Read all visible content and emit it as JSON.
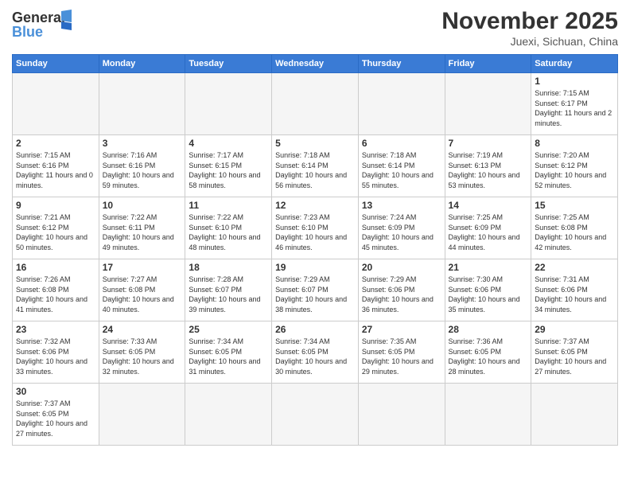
{
  "header": {
    "logo_general": "General",
    "logo_blue": "Blue",
    "month_year": "November 2025",
    "location": "Juexi, Sichuan, China"
  },
  "weekdays": [
    "Sunday",
    "Monday",
    "Tuesday",
    "Wednesday",
    "Thursday",
    "Friday",
    "Saturday"
  ],
  "weeks": [
    [
      {
        "day": "",
        "info": ""
      },
      {
        "day": "",
        "info": ""
      },
      {
        "day": "",
        "info": ""
      },
      {
        "day": "",
        "info": ""
      },
      {
        "day": "",
        "info": ""
      },
      {
        "day": "",
        "info": ""
      },
      {
        "day": "1",
        "info": "Sunrise: 7:15 AM\nSunset: 6:17 PM\nDaylight: 11 hours and 2 minutes."
      }
    ],
    [
      {
        "day": "2",
        "info": "Sunrise: 7:15 AM\nSunset: 6:16 PM\nDaylight: 11 hours and 0 minutes."
      },
      {
        "day": "3",
        "info": "Sunrise: 7:16 AM\nSunset: 6:16 PM\nDaylight: 10 hours and 59 minutes."
      },
      {
        "day": "4",
        "info": "Sunrise: 7:17 AM\nSunset: 6:15 PM\nDaylight: 10 hours and 58 minutes."
      },
      {
        "day": "5",
        "info": "Sunrise: 7:18 AM\nSunset: 6:14 PM\nDaylight: 10 hours and 56 minutes."
      },
      {
        "day": "6",
        "info": "Sunrise: 7:18 AM\nSunset: 6:14 PM\nDaylight: 10 hours and 55 minutes."
      },
      {
        "day": "7",
        "info": "Sunrise: 7:19 AM\nSunset: 6:13 PM\nDaylight: 10 hours and 53 minutes."
      },
      {
        "day": "8",
        "info": "Sunrise: 7:20 AM\nSunset: 6:12 PM\nDaylight: 10 hours and 52 minutes."
      }
    ],
    [
      {
        "day": "9",
        "info": "Sunrise: 7:21 AM\nSunset: 6:12 PM\nDaylight: 10 hours and 50 minutes."
      },
      {
        "day": "10",
        "info": "Sunrise: 7:22 AM\nSunset: 6:11 PM\nDaylight: 10 hours and 49 minutes."
      },
      {
        "day": "11",
        "info": "Sunrise: 7:22 AM\nSunset: 6:10 PM\nDaylight: 10 hours and 48 minutes."
      },
      {
        "day": "12",
        "info": "Sunrise: 7:23 AM\nSunset: 6:10 PM\nDaylight: 10 hours and 46 minutes."
      },
      {
        "day": "13",
        "info": "Sunrise: 7:24 AM\nSunset: 6:09 PM\nDaylight: 10 hours and 45 minutes."
      },
      {
        "day": "14",
        "info": "Sunrise: 7:25 AM\nSunset: 6:09 PM\nDaylight: 10 hours and 44 minutes."
      },
      {
        "day": "15",
        "info": "Sunrise: 7:25 AM\nSunset: 6:08 PM\nDaylight: 10 hours and 42 minutes."
      }
    ],
    [
      {
        "day": "16",
        "info": "Sunrise: 7:26 AM\nSunset: 6:08 PM\nDaylight: 10 hours and 41 minutes."
      },
      {
        "day": "17",
        "info": "Sunrise: 7:27 AM\nSunset: 6:08 PM\nDaylight: 10 hours and 40 minutes."
      },
      {
        "day": "18",
        "info": "Sunrise: 7:28 AM\nSunset: 6:07 PM\nDaylight: 10 hours and 39 minutes."
      },
      {
        "day": "19",
        "info": "Sunrise: 7:29 AM\nSunset: 6:07 PM\nDaylight: 10 hours and 38 minutes."
      },
      {
        "day": "20",
        "info": "Sunrise: 7:29 AM\nSunset: 6:06 PM\nDaylight: 10 hours and 36 minutes."
      },
      {
        "day": "21",
        "info": "Sunrise: 7:30 AM\nSunset: 6:06 PM\nDaylight: 10 hours and 35 minutes."
      },
      {
        "day": "22",
        "info": "Sunrise: 7:31 AM\nSunset: 6:06 PM\nDaylight: 10 hours and 34 minutes."
      }
    ],
    [
      {
        "day": "23",
        "info": "Sunrise: 7:32 AM\nSunset: 6:06 PM\nDaylight: 10 hours and 33 minutes."
      },
      {
        "day": "24",
        "info": "Sunrise: 7:33 AM\nSunset: 6:05 PM\nDaylight: 10 hours and 32 minutes."
      },
      {
        "day": "25",
        "info": "Sunrise: 7:34 AM\nSunset: 6:05 PM\nDaylight: 10 hours and 31 minutes."
      },
      {
        "day": "26",
        "info": "Sunrise: 7:34 AM\nSunset: 6:05 PM\nDaylight: 10 hours and 30 minutes."
      },
      {
        "day": "27",
        "info": "Sunrise: 7:35 AM\nSunset: 6:05 PM\nDaylight: 10 hours and 29 minutes."
      },
      {
        "day": "28",
        "info": "Sunrise: 7:36 AM\nSunset: 6:05 PM\nDaylight: 10 hours and 28 minutes."
      },
      {
        "day": "29",
        "info": "Sunrise: 7:37 AM\nSunset: 6:05 PM\nDaylight: 10 hours and 27 minutes."
      }
    ],
    [
      {
        "day": "30",
        "info": "Sunrise: 7:37 AM\nSunset: 6:05 PM\nDaylight: 10 hours and 27 minutes."
      },
      {
        "day": "",
        "info": ""
      },
      {
        "day": "",
        "info": ""
      },
      {
        "day": "",
        "info": ""
      },
      {
        "day": "",
        "info": ""
      },
      {
        "day": "",
        "info": ""
      },
      {
        "day": "",
        "info": ""
      }
    ]
  ]
}
